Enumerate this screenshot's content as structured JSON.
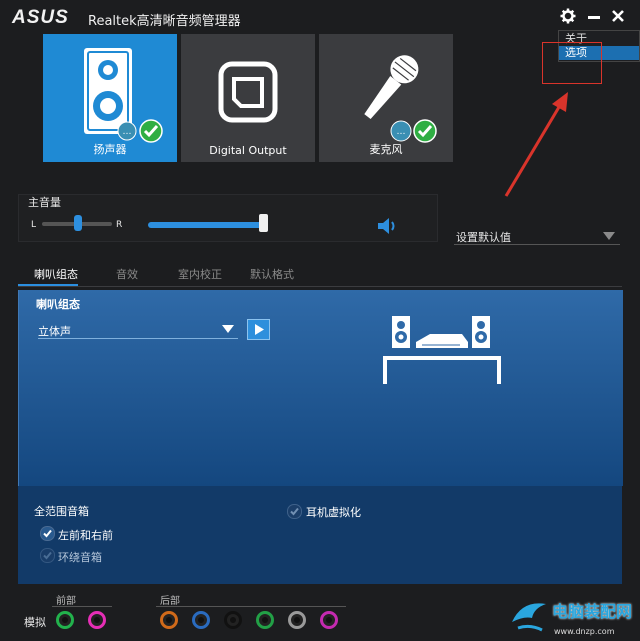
{
  "titlebar": {
    "logo": "ASUS",
    "title": "Realtek高清晰音频管理器"
  },
  "menu": {
    "items": [
      {
        "label": "关于",
        "selected": false
      },
      {
        "label": "选项",
        "selected": true
      }
    ]
  },
  "devices": [
    {
      "label": "扬声器",
      "active": true
    },
    {
      "label": "Digital Output",
      "active": false
    },
    {
      "label": "麦克风",
      "active": false
    }
  ],
  "volume": {
    "title": "主音量",
    "left_label": "L",
    "right_label": "R",
    "balance_level": 0.5,
    "volume_level": 0.98
  },
  "default_device": {
    "label": "设置默认值"
  },
  "tabs": [
    {
      "label": "喇叭组态",
      "active": true
    },
    {
      "label": "音效",
      "active": false
    },
    {
      "label": "室内校正",
      "active": false
    },
    {
      "label": "默认格式",
      "active": false
    }
  ],
  "speaker_config": {
    "title": "喇叭组态",
    "selected": "立体声"
  },
  "options": {
    "full_range_title": "全范围音箱",
    "front_lr": {
      "label": "左前和右前",
      "checked": true
    },
    "surround": {
      "label": "环绕音箱",
      "checked": false
    },
    "headphone_virtual": {
      "label": "耳机虚拟化",
      "checked": false
    }
  },
  "jacks": {
    "analog_label": "模拟",
    "front_label": "前部",
    "rear_label": "后部",
    "front_colors": [
      "#22b24c",
      "#e62eb6"
    ],
    "rear_colors": [
      "#d06a1a",
      "#2a6bbf",
      "#111111",
      "#22a046",
      "#9a9a9a",
      "#c42ab0"
    ]
  },
  "watermark": {
    "text1": "电脑装配网",
    "text2": "www.dnzp.com"
  },
  "colors": {
    "accent": "#1f8ad4",
    "annotation": "#d9342b"
  }
}
